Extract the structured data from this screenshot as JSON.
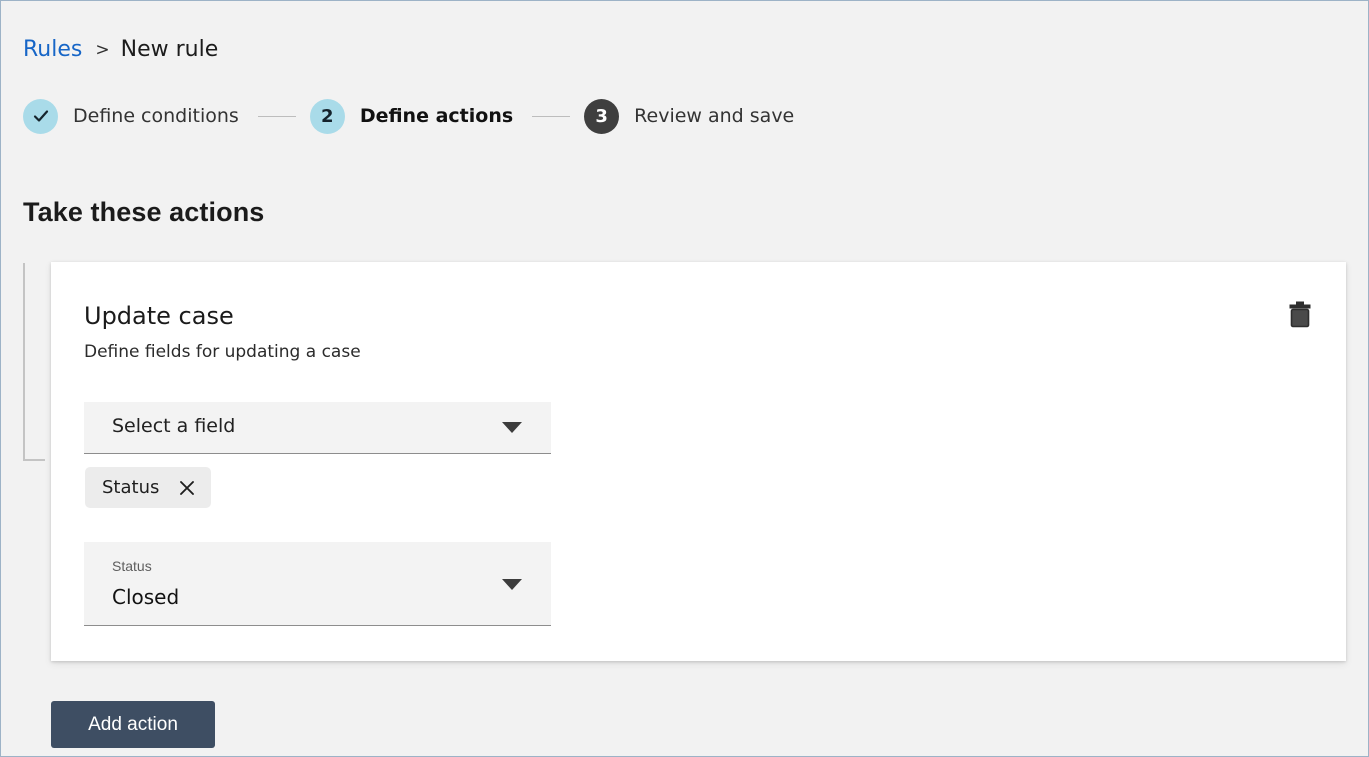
{
  "breadcrumb": {
    "root_label": "Rules",
    "separator": ">",
    "current_label": "New rule"
  },
  "stepper": {
    "steps": [
      {
        "indicator": "✓",
        "label": "Define conditions",
        "state": "done"
      },
      {
        "indicator": "2",
        "label": "Define actions",
        "state": "active"
      },
      {
        "indicator": "3",
        "label": "Review and save",
        "state": "todo"
      }
    ]
  },
  "section": {
    "title": "Take these actions"
  },
  "action_card": {
    "title": "Update case",
    "subtitle": "Define fields for updating a case",
    "delete_icon": "trash-icon",
    "field_select": {
      "placeholder": "Select a field",
      "arrow_icon": "chevron-down-icon"
    },
    "selected_chips": [
      {
        "label": "Status",
        "remove_icon": "close-icon"
      }
    ],
    "value_select": {
      "label": "Status",
      "value": "Closed",
      "arrow_icon": "chevron-down-icon"
    }
  },
  "footer": {
    "add_action_label": "Add action"
  },
  "colors": {
    "page_background": "#f2f2f2",
    "page_border": "#9db3c7",
    "link": "#1766c7",
    "step_done": "#a9dbe9",
    "step_active": "#a9dbe9",
    "step_todo": "#3f3f3f",
    "card_background": "#ffffff",
    "field_background": "#f3f3f3",
    "chip_background": "#ececec",
    "primary_button": "#3e4e63"
  }
}
